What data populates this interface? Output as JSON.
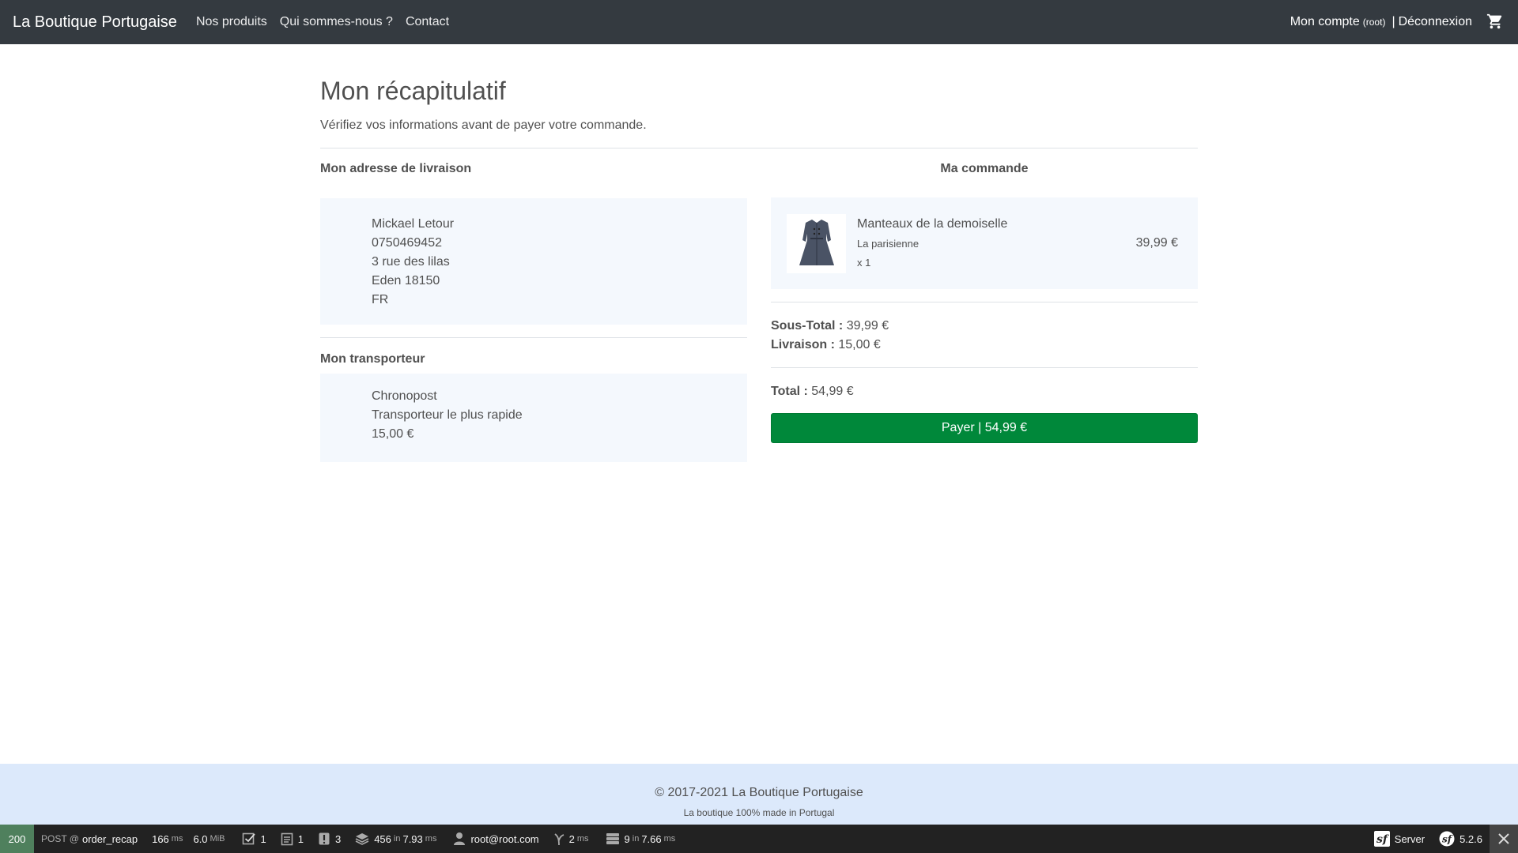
{
  "nav": {
    "brand": "La Boutique Portugaise",
    "links": [
      "Nos produits",
      "Qui sommes-nous ?",
      "Contact"
    ],
    "account": "Mon compte",
    "account_user": "(root)",
    "separator": "|",
    "logout": "Déconnexion",
    "cart_icon": "cart-icon"
  },
  "page": {
    "title": "Mon récapitulatif",
    "subtitle": "Vérifiez vos informations avant de payer votre commande."
  },
  "address": {
    "title": "Mon adresse de livraison",
    "lines": [
      "Mickael Letour",
      "0750469452",
      "3 rue des lilas",
      "Eden 18150",
      "FR"
    ]
  },
  "carrier": {
    "title": "Mon transporteur",
    "lines": [
      "Chronopost",
      "Transporteur le plus rapide",
      "15,00 €"
    ]
  },
  "order": {
    "title": "Ma commande",
    "product": {
      "name": "Manteaux de la demoiselle",
      "subtitle": "La parisienne",
      "quantity": "x 1",
      "price": "39,99 €"
    },
    "subtotal_label": "Sous-Total :",
    "subtotal_value": "39,99 €",
    "shipping_label": "Livraison :",
    "shipping_value": "15,00 €",
    "total_label": "Total :",
    "total_value": "54,99 €",
    "pay_button": "Payer | 54,99 €",
    "pay_color": "#00883a"
  },
  "footer": {
    "copyright": "© 2017-2021 La Boutique Portugaise",
    "tagline": "La boutique 100% made in Portugal"
  },
  "toolbar": {
    "status": "200",
    "method": "POST @",
    "route": "order_recap",
    "time": "166",
    "time_unit": "ms",
    "memory": "6.0",
    "memory_unit": "MiB",
    "forms": "1",
    "logs": "1",
    "errors": "3",
    "cache": "456",
    "cache_in": "in",
    "cache_time": "7.93",
    "cache_unit": "ms",
    "user": "root@root.com",
    "twig_time": "2",
    "twig_unit": "ms",
    "db_queries": "9",
    "db_in": "in",
    "db_time": "7.66",
    "db_unit": "ms",
    "server": "Server",
    "version": "5.2.6"
  }
}
